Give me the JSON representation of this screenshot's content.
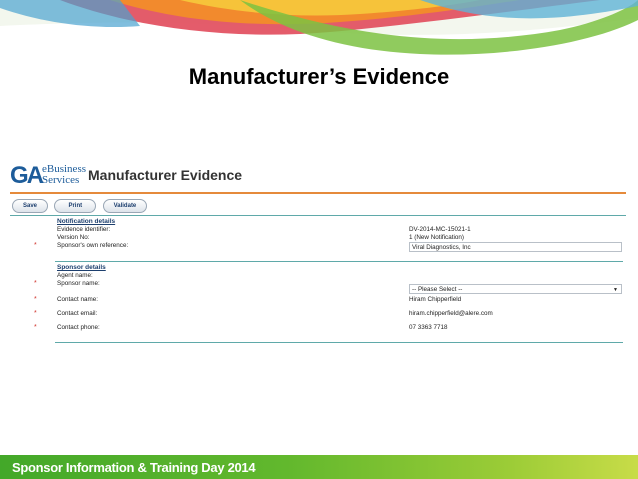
{
  "slide": {
    "title": "Manufacturer’s Evidence",
    "footer": "Sponsor Information  & Training Day 2014"
  },
  "app": {
    "logo_mark": "GA",
    "logo_line1": "eBusiness",
    "logo_line2": "Services",
    "title": "Manufacturer Evidence",
    "colors": {
      "accent_orange": "#e58a3b",
      "brand_blue": "#1d5c9a",
      "required_red": "#d0322b"
    }
  },
  "toolbar": {
    "save_label": "Save",
    "print_label": "Print",
    "validate_label": "Validate"
  },
  "notification": {
    "heading": "Notification details",
    "evidence_identifier_label": "Evidence identifier:",
    "evidence_identifier_value": "DV-2014-MC-15021-1",
    "version_label": "Version No:",
    "version_value": "1 (New Notification)",
    "sponsor_ref_label": "Sponsor's own reference:",
    "sponsor_ref_value": "Viral Diagnostics, Inc"
  },
  "sponsor": {
    "heading": "Sponsor details",
    "agent_name_label": "Agent name:",
    "sponsor_name_label": "Sponsor name:",
    "sponsor_name_value": "-- Please Select --",
    "contact_name_label": "Contact name:",
    "contact_name_value": "Hiram Chipperfield",
    "contact_email_label": "Contact email:",
    "contact_email_value": "hiram.chipperfield@alere.com",
    "contact_phone_label": "Contact phone:",
    "contact_phone_value": "07 3363 7718"
  },
  "required_marker": "*"
}
